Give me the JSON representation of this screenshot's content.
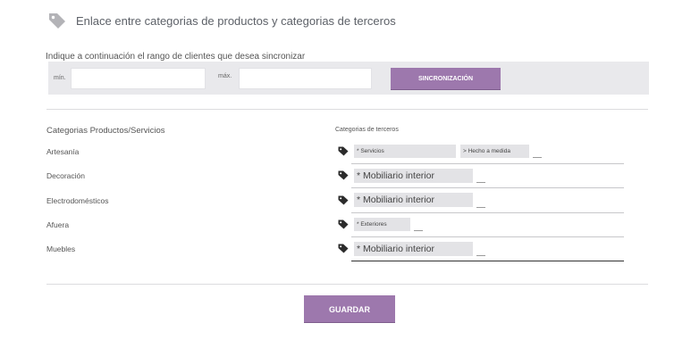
{
  "header": {
    "title": "Enlace entre categorias de productos y categorias de terceros",
    "icon": "tag-icon"
  },
  "sync": {
    "intro": "Indique a continuación el rango de clientes que desea sincronizar",
    "min_label": "mín.",
    "max_label": "máx.",
    "min_value": "",
    "max_value": "",
    "button_label": "SINCRONIZACIÓN"
  },
  "mapping": {
    "product_header": "Categorias Productos/Servicios",
    "third_party_header": "Categorias de terceros",
    "rows": [
      {
        "label": "Artesanía",
        "chips": [
          "* Servicios",
          "> Hecho a medida"
        ]
      },
      {
        "label": "Decoración",
        "chips": [
          "* Mobiliario interior"
        ]
      },
      {
        "label": "Electrodomésticos",
        "chips": [
          "* Mobiliario interior"
        ]
      },
      {
        "label": "Afuera",
        "chips": [
          "* Exteriores"
        ]
      },
      {
        "label": "Muebles",
        "chips": [
          "* Mobiliario interior"
        ]
      }
    ]
  },
  "footer": {
    "save_label": "GUARDAR"
  },
  "colors": {
    "accent": "#9d78ad",
    "bar_background": "#e9e9ec",
    "chip_background": "#e3e3e6",
    "icon_gray": "#b3b3b7",
    "tag_dark": "#2b2b2b"
  }
}
